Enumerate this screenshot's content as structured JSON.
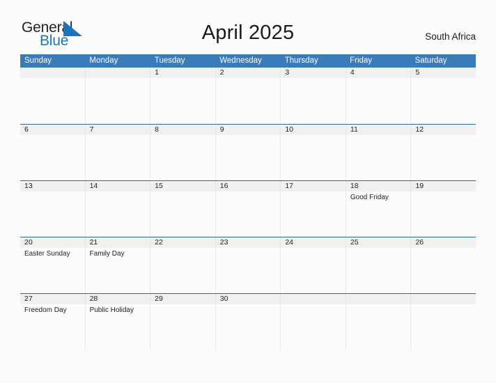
{
  "brand": {
    "word_one": "General",
    "word_two": "Blue",
    "triangle_icon": "triangle-flag-icon",
    "color_dark": "#231f20",
    "color_blue": "#1b75bc"
  },
  "header": {
    "title": "April 2025",
    "region": "South Africa"
  },
  "theme": {
    "header_blue": "#3b7ab8",
    "row_rule_blue": "#2f6ca5",
    "daynum_band_gray": "#f0f0f0",
    "page_background": "#fcfcfd",
    "cell_divider": "#e8e8e8"
  },
  "calendar": {
    "month": "April",
    "year": "2025",
    "weekday_headers": [
      "Sunday",
      "Monday",
      "Tuesday",
      "Wednesday",
      "Thursday",
      "Friday",
      "Saturday"
    ],
    "weeks": [
      [
        {
          "day": "",
          "event": ""
        },
        {
          "day": "",
          "event": ""
        },
        {
          "day": "1",
          "event": ""
        },
        {
          "day": "2",
          "event": ""
        },
        {
          "day": "3",
          "event": ""
        },
        {
          "day": "4",
          "event": ""
        },
        {
          "day": "5",
          "event": ""
        }
      ],
      [
        {
          "day": "6",
          "event": ""
        },
        {
          "day": "7",
          "event": ""
        },
        {
          "day": "8",
          "event": ""
        },
        {
          "day": "9",
          "event": ""
        },
        {
          "day": "10",
          "event": ""
        },
        {
          "day": "11",
          "event": ""
        },
        {
          "day": "12",
          "event": ""
        }
      ],
      [
        {
          "day": "13",
          "event": ""
        },
        {
          "day": "14",
          "event": ""
        },
        {
          "day": "15",
          "event": ""
        },
        {
          "day": "16",
          "event": ""
        },
        {
          "day": "17",
          "event": ""
        },
        {
          "day": "18",
          "event": "Good Friday"
        },
        {
          "day": "19",
          "event": ""
        }
      ],
      [
        {
          "day": "20",
          "event": "Easter Sunday"
        },
        {
          "day": "21",
          "event": "Family Day"
        },
        {
          "day": "22",
          "event": ""
        },
        {
          "day": "23",
          "event": ""
        },
        {
          "day": "24",
          "event": ""
        },
        {
          "day": "25",
          "event": ""
        },
        {
          "day": "26",
          "event": ""
        }
      ],
      [
        {
          "day": "27",
          "event": "Freedom Day"
        },
        {
          "day": "28",
          "event": "Public Holiday"
        },
        {
          "day": "29",
          "event": ""
        },
        {
          "day": "30",
          "event": ""
        },
        {
          "day": "",
          "event": ""
        },
        {
          "day": "",
          "event": ""
        },
        {
          "day": "",
          "event": ""
        }
      ]
    ]
  }
}
